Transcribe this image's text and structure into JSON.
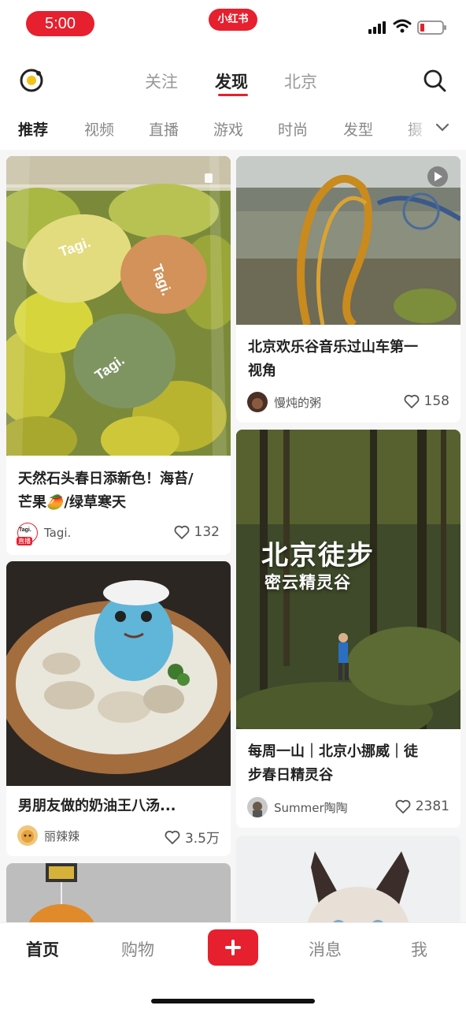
{
  "status_bar": {
    "time": "5:00",
    "app_badge": "小红书"
  },
  "header": {
    "tabs": [
      "关注",
      "发现",
      "北京"
    ],
    "active_tab": "发现"
  },
  "categories": {
    "items": [
      "推荐",
      "视频",
      "直播",
      "游戏",
      "时尚",
      "发型",
      "摄"
    ],
    "active": "推荐"
  },
  "feed": {
    "left": [
      {
        "title_line1": "天然石头春日添新色！海苔/",
        "title_line2": "芒果🥭/绿草寒天",
        "author": "Tagi.",
        "author_logo_text": "Tagi.",
        "live_label": "直播",
        "likes": "132"
      },
      {
        "title_line1": "男朋友做的奶油王八汤...",
        "author": "丽辣辣",
        "likes": "3.5万"
      },
      {
        "title_line1": "",
        "author": "",
        "likes": ""
      }
    ],
    "right": [
      {
        "title_line1": "北京欢乐谷音乐过山车第一",
        "title_line2": "视角",
        "author": "慢炖的粥",
        "likes": "158"
      },
      {
        "overlay_title": "北京徒步",
        "overlay_subtitle": "密云精灵谷",
        "title_line1": "每周一山｜北京小挪威｜徒",
        "title_line2": "步春日精灵谷",
        "author": "Summer陶陶",
        "likes": "2381"
      },
      {
        "title_line1": "",
        "author": "",
        "likes": ""
      }
    ]
  },
  "product_text": [
    "Tagi.",
    "Tagi.",
    "Tagi."
  ],
  "bottom_nav": {
    "items": [
      "首页",
      "购物",
      "消息",
      "我"
    ],
    "active": "首页"
  },
  "colors": {
    "brand": "#e6202e",
    "text": "#222222",
    "muted": "#888888"
  }
}
